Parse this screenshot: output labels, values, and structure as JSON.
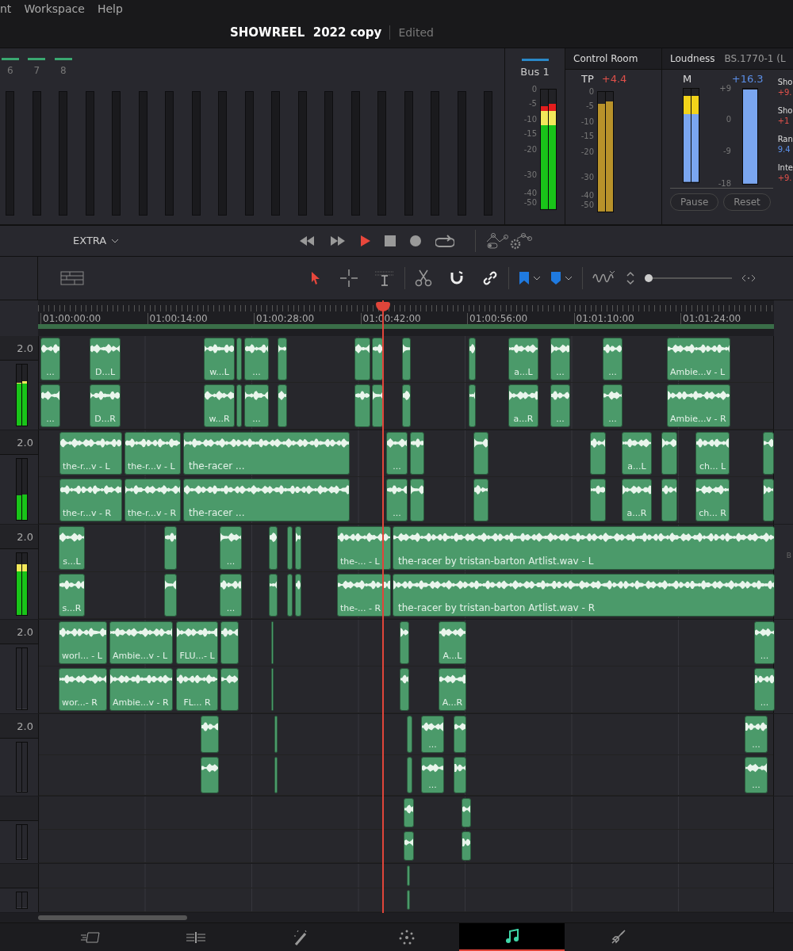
{
  "menu": [
    "nt",
    "Workspace",
    "Help"
  ],
  "project": {
    "title": "SHOWREEL  2022 copy",
    "status": "Edited"
  },
  "mixer": {
    "channels": [
      {
        "number": "6"
      },
      {
        "number": "7"
      },
      {
        "number": "8"
      }
    ]
  },
  "bus": {
    "name": "Bus 1",
    "scale": [
      "0",
      "-5",
      "-10",
      "-15",
      "-20",
      "-30",
      "-40",
      "-50"
    ],
    "meters": [
      {
        "level": 0.86
      },
      {
        "level": 0.88
      }
    ]
  },
  "control_room": {
    "title": "Control Room",
    "tp_label": "TP",
    "tp_value": "+4.4",
    "scale": [
      "0",
      "-5",
      "-10",
      "-15",
      "-20",
      "-30",
      "-40",
      "-50"
    ],
    "meters": [
      {
        "level": 0.9
      },
      {
        "level": 0.92
      }
    ]
  },
  "loudness": {
    "title": "Loudness",
    "standard": "BS.1770-1 (L",
    "m_label": "M",
    "value": "+16.3",
    "scale": [
      "+9",
      "0",
      "-9",
      "-18"
    ],
    "meters": [
      {
        "level": 0.92
      },
      {
        "level": 0.92
      }
    ],
    "integrated_meter": {
      "level": 0.99
    },
    "readings": [
      {
        "label": "Sho",
        "value": "+9.",
        "color": "#e0504a"
      },
      {
        "label": "Sho",
        "value": "+1",
        "color": "#e0504a"
      },
      {
        "label": "Ran",
        "value": "9.4",
        "color": "#5b8ee6"
      },
      {
        "label": "Inte",
        "value": "+9.",
        "color": "#e0504a"
      }
    ],
    "buttons": [
      "Pause",
      "Reset"
    ]
  },
  "transport": {
    "bin": "EXTRA",
    "controls": [
      {
        "kind": "rewind"
      },
      {
        "kind": "forward"
      },
      {
        "kind": "play"
      },
      {
        "kind": "stop"
      },
      {
        "kind": "record"
      },
      {
        "kind": "loop"
      }
    ]
  },
  "tools": [
    {
      "kind": "pointer",
      "selected": true
    },
    {
      "kind": "crosshair",
      "selected": false
    },
    {
      "kind": "trim",
      "selected": false
    }
  ],
  "edit_tools": [
    {
      "kind": "scissors",
      "on": false
    },
    {
      "kind": "magnet",
      "on": true
    },
    {
      "kind": "link",
      "on": true
    }
  ],
  "ruler": [
    "01:00:00:00",
    "01:00:14:00",
    "01:00:28:00",
    "01:00:42:00",
    "01:00:56:00",
    "01:01:10:00",
    "01:01:24:00"
  ],
  "tracks": [
    {
      "format": "2.0",
      "meters": [
        {
          "level": 0.71
        },
        {
          "level": 0.73
        }
      ],
      "lanes": [
        [
          "...",
          "D...L",
          "w...L",
          "...",
          "a...L",
          "...",
          "...",
          "Ambie...v - L"
        ],
        [
          "...",
          "D...R",
          "w...R",
          "...",
          "a...R",
          "...",
          "...",
          "Ambie...v - R"
        ]
      ]
    },
    {
      "format": "2.0",
      "meters": [
        {
          "level": 0.4
        },
        {
          "level": 0.42
        }
      ],
      "lanes": [
        [
          "the-r...v - L",
          "the-r...v - L",
          "the-racer ...",
          "...",
          "a...L",
          "ch... L"
        ],
        [
          "the-r...v - R",
          "the-r...v - R",
          "the-racer ...",
          "...",
          "a...R",
          "ch... R"
        ]
      ]
    },
    {
      "format": "2.0",
      "meters": [
        {
          "level": 0.82
        },
        {
          "level": 0.82
        }
      ],
      "lanes": [
        [
          "s...L",
          "...",
          "the-... - L",
          "the-racer by tristan-barton Artlist.wav - L"
        ],
        [
          "s...R",
          "...",
          "the-... - R",
          "the-racer by tristan-barton Artlist.wav - R"
        ]
      ]
    },
    {
      "format": "2.0",
      "meters": [
        {
          "level": 0
        },
        {
          "level": 0
        }
      ],
      "lanes": [
        [
          "worl... - L",
          "Ambie...v - L",
          "FLU...- L",
          "A...L",
          "..."
        ],
        [
          "wor...- R",
          "Ambie...v - R",
          "FL... R",
          "A...R",
          "..."
        ]
      ]
    },
    {
      "format": "2.0",
      "meters": [
        {
          "level": 0
        },
        {
          "level": 0
        }
      ],
      "lanes": [
        [
          "...",
          "..."
        ],
        [
          "...",
          "..."
        ]
      ]
    },
    {
      "meters": [
        {
          "level": 0
        },
        {
          "level": 0
        }
      ]
    },
    {
      "meters": [
        {
          "level": 0
        },
        {
          "level": 0
        }
      ]
    }
  ],
  "zoom": {
    "level": 0
  },
  "side_label": "B",
  "pages": [
    {
      "kind": "film",
      "selected": false
    },
    {
      "kind": "timeline",
      "selected": false
    },
    {
      "kind": "wand",
      "selected": false
    },
    {
      "kind": "dots",
      "selected": false
    },
    {
      "kind": "music",
      "selected": true
    },
    {
      "kind": "rocket",
      "selected": false
    }
  ]
}
